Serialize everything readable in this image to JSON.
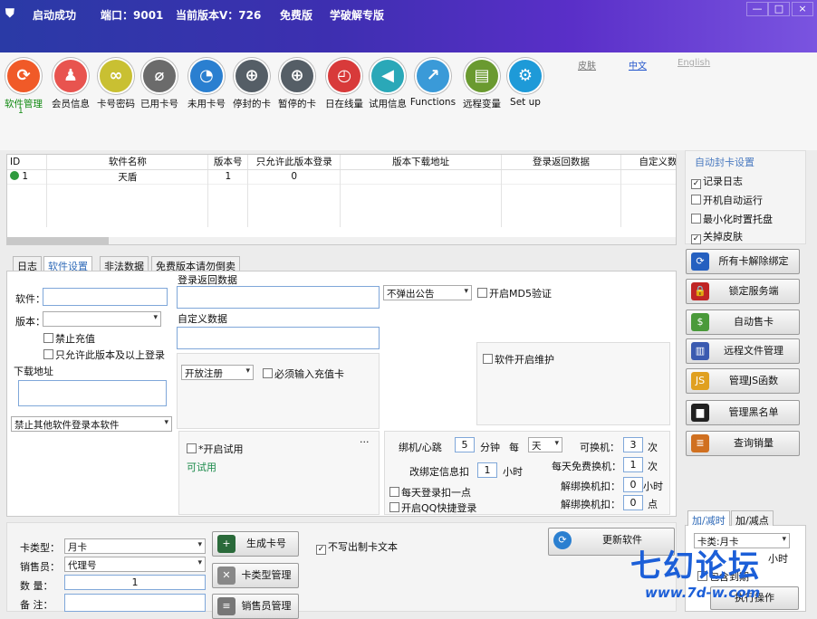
{
  "window": {
    "title": "启动成功",
    "port": "端口：9001",
    "version": "当前版本V：726",
    "edition": "免费版",
    "learn": "学破解专版",
    "min": "—",
    "max": "□",
    "close": "×"
  },
  "toolbar": {
    "items": [
      {
        "label": "软件管理",
        "color": "#f05a28",
        "glyph": "⟳",
        "active": true
      },
      {
        "label": "会员信息",
        "color": "#e8544f",
        "glyph": "♟"
      },
      {
        "label": "卡号密码",
        "color": "#c9c032",
        "glyph": "∞"
      },
      {
        "label": "已用卡号",
        "color": "#6b6b6b",
        "glyph": "⌀"
      },
      {
        "label": "未用卡号",
        "color": "#2a7fd0",
        "glyph": "◔"
      },
      {
        "label": "停封的卡",
        "color": "#555e66",
        "glyph": "⊕"
      },
      {
        "label": "暂停的卡",
        "color": "#555e66",
        "glyph": "⊕"
      },
      {
        "label": "日在线量",
        "color": "#d83a3a",
        "glyph": "◴"
      },
      {
        "label": "试用信息",
        "color": "#2aa8b8",
        "glyph": "◀"
      },
      {
        "label": "Functions",
        "color": "#3a9ad8",
        "glyph": "↗"
      },
      {
        "label": "远程变量",
        "color": "#6a9a30",
        "glyph": "▤"
      },
      {
        "label": "Set up",
        "color": "#1e9ad8",
        "glyph": "⚙"
      }
    ],
    "active_index": "1",
    "skin": "皮肤",
    "chinese": "中文",
    "english": "English"
  },
  "grid": {
    "columns": [
      "ID",
      "软件名称",
      "版本号",
      "只允许此版本登录",
      "版本下载地址",
      "登录返回数据",
      "自定义数"
    ],
    "rows": [
      {
        "id": "1",
        "name": "天盾",
        "version": "1",
        "only": "0",
        "url": "",
        "ret": "",
        "custom": ""
      }
    ]
  },
  "right_settings": {
    "title": "自动封卡设置",
    "record_log": "记录日志",
    "auto_run": "开机自动运行",
    "min_tray": "最小化时置托盘",
    "close_skin": "关掉皮肤"
  },
  "right_buttons": [
    {
      "label": "所有卡解除绑定",
      "color": "#2560c0",
      "glyph": "⟳"
    },
    {
      "label": "锁定服务端",
      "color": "#c02525",
      "glyph": "🔒"
    },
    {
      "label": "自动售卡",
      "color": "#4a9a3a",
      "glyph": "$"
    },
    {
      "label": "远程文件管理",
      "color": "#3a5ab0",
      "glyph": "▥"
    },
    {
      "label": "管理JS函数",
      "color": "#e0a020",
      "glyph": "JS"
    },
    {
      "label": "管理黑名单",
      "color": "#222",
      "glyph": "▆"
    },
    {
      "label": "查询销量",
      "color": "#d07020",
      "glyph": "≣"
    }
  ],
  "tabs": [
    "日志",
    "软件设置",
    "非法数据",
    "免费版本请勿倒卖"
  ],
  "form": {
    "software": "软件：",
    "version": "版本：",
    "stop_recharge": "禁止充值",
    "only_version": "只允许此版本及以上登录",
    "download": "下载地址",
    "forbid_other": "禁止其他软件登录本软件",
    "login_return": "登录返回数据",
    "custom_data": "自定义数据",
    "announce": "不弹出公告",
    "md5": "开启MD5验证",
    "open_reg": "开放注册",
    "must_card": "必须输入充值卡",
    "maintenance": "软件开启维护",
    "trial": "*开启试用",
    "can_trial": "可试用",
    "dots": "···",
    "bind": "绑机/心跳",
    "bind_val": "5",
    "minute": "分钟",
    "every": "每",
    "day": "天",
    "can_change": "可换机：",
    "can_change_val": "3",
    "times": "次",
    "change_bind": "改绑定信息扣",
    "change_bind_val": "1",
    "hour": "小时",
    "free_change": "每天免费换机：",
    "free_change_val": "1",
    "times2": "次",
    "unbind1": "解绑换机扣：",
    "unbind1_val": "0",
    "hour2": "小时",
    "unbind2": "解绑换机扣：",
    "unbind2_val": "0",
    "point": "点",
    "daily_login": "每天登录扣一点",
    "qq_login": "开启QQ快捷登录"
  },
  "gen": {
    "card_type": "卡类型：",
    "card_type_val": "月卡",
    "seller": "销售员：",
    "seller_val": "代理号",
    "qty": "数  量：",
    "qty_val": "1",
    "note": "备  注：",
    "gen_btn": "生成卡号",
    "type_btn": "卡类型管理",
    "seller_btn": "销售员管理",
    "no_write": "不写出制卡文本",
    "update_btn": "更新软件"
  },
  "addtime": {
    "tab1": "加/减时",
    "tab2": "加/减点",
    "card": "卡类:月卡",
    "hours": "小时",
    "cb": "包含到期",
    "exec": "执行操作"
  },
  "watermark": {
    "brand": "七幻论坛",
    "url": "www.7d-w.com"
  }
}
